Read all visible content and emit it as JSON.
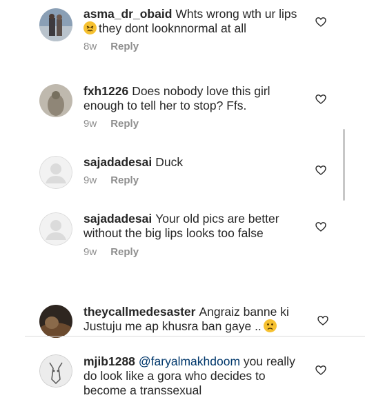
{
  "comments": [
    {
      "username": "asma_dr_obaid",
      "text1": "Whts wrong wth ur lips",
      "text2": "they dont looknnormal at all",
      "emoji": "confounded-face-emoji",
      "time": "8w",
      "reply": "Reply"
    },
    {
      "username": "fxh1226",
      "text": "Does nobody love this girl enough to tell her to stop? Ffs.",
      "time": "9w",
      "reply": "Reply"
    },
    {
      "username": "sajadadesai",
      "text": "Duck",
      "time": "9w",
      "reply": "Reply"
    },
    {
      "username": "sajadadesai",
      "text": "Your old pics are better without the big lips looks too false",
      "time": "9w",
      "reply": "Reply"
    },
    {
      "username": "theycallmedesaster",
      "text": "Angraiz banne ki Justuju me ap khusra ban gaye ..",
      "emoji": "confused-face-emoji"
    },
    {
      "username": "mjib1288",
      "mention": "@faryalmakhdoom",
      "text": "you really do look like a gora who decides to become a transsexual"
    }
  ],
  "colors": {
    "text": "#262626",
    "secondary": "#8e8e8e",
    "mention": "#00376b",
    "divider": "#dbdbdb"
  }
}
